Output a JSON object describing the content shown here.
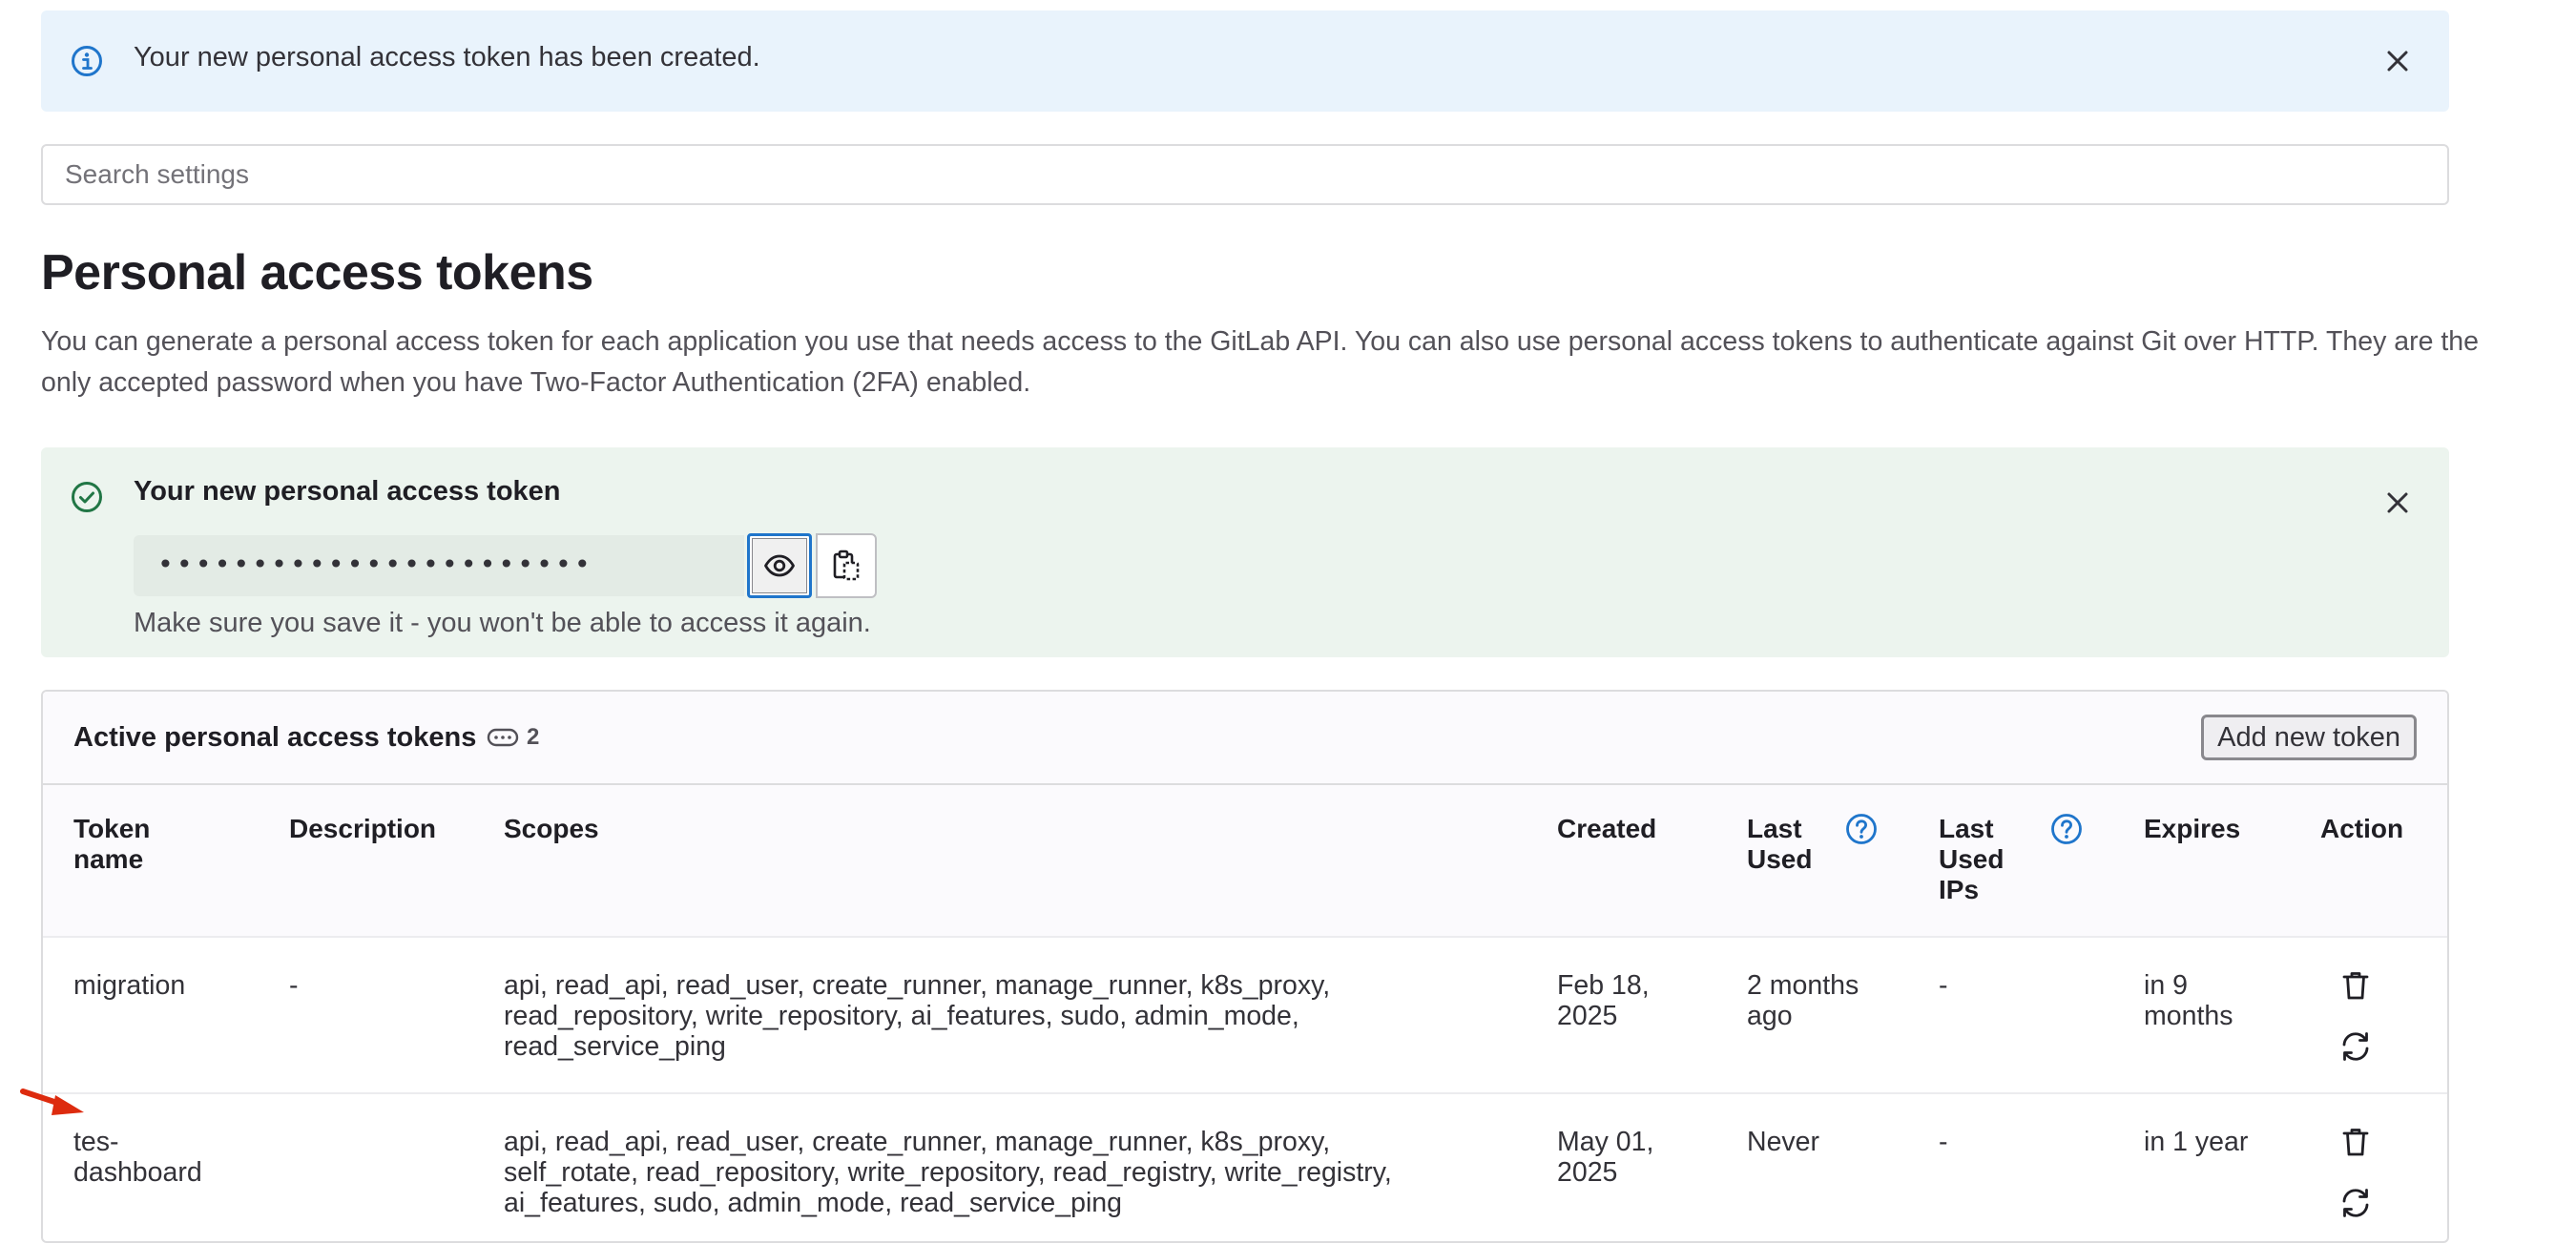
{
  "alert_info": {
    "message": "Your new personal access token has been created."
  },
  "search": {
    "placeholder": "Search settings"
  },
  "page": {
    "title": "Personal access tokens",
    "description": "You can generate a personal access token for each application you use that needs access to the GitLab API. You can also use personal access tokens to authenticate against Git over HTTP. They are the only accepted password when you have Two-Factor Authentication (2FA) enabled."
  },
  "new_token": {
    "heading": "Your new personal access token",
    "masked_value": "•••••••••••••••••••••••",
    "note": "Make sure you save it - you won't be able to access it again."
  },
  "tokens_card": {
    "title": "Active personal access tokens",
    "count": "2",
    "add_button": "Add new token",
    "columns": {
      "token_name": "Token name",
      "description": "Description",
      "scopes": "Scopes",
      "created": "Created",
      "last_used": "Last Used",
      "last_used_ips": "Last Used IPs",
      "expires": "Expires",
      "action": "Action"
    },
    "rows": [
      {
        "token_name": "migration",
        "description": "-",
        "scopes": "api, read_api, read_user, create_runner, manage_runner, k8s_proxy, read_repository, write_repository, ai_features, sudo, admin_mode, read_service_ping",
        "created": "Feb 18, 2025",
        "last_used": "2 months ago",
        "last_used_ips": "-",
        "expires": "in 9 months"
      },
      {
        "token_name": "tes-dashboard",
        "description": "",
        "scopes": "api, read_api, read_user, create_runner, manage_runner, k8s_proxy, self_rotate, read_repository, write_repository, read_registry, write_registry, ai_features, sudo, admin_mode, read_service_ping",
        "created": "May 01, 2025",
        "last_used": "Never",
        "last_used_ips": "-",
        "expires": "in 1 year"
      }
    ]
  },
  "icons": {
    "info": "info-circle-icon",
    "success": "check-circle-icon",
    "close": "close-icon",
    "eye": "eye-icon",
    "copy": "copy-to-clipboard-icon",
    "token": "token-icon",
    "help": "question-circle-icon",
    "delete": "trash-icon",
    "rotate": "retry-icon",
    "annotation": "red-arrow-annotation"
  },
  "colors": {
    "info_bg": "#e9f3fc",
    "success_bg": "#ecf4ee",
    "info_accent": "#1f75cb",
    "success_accent": "#217645",
    "annotation_arrow": "#dd2b0e"
  }
}
